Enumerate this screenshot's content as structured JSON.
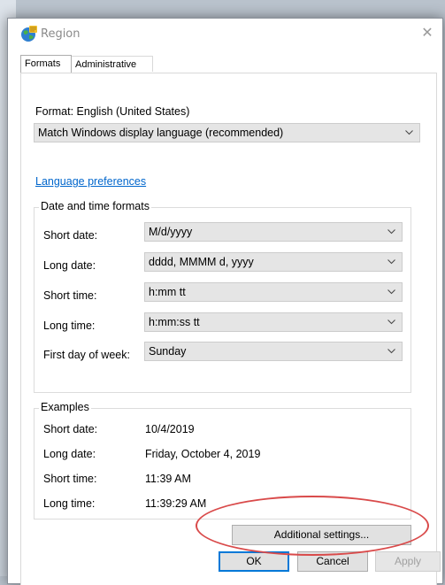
{
  "window": {
    "title": "Region",
    "close_glyph": "✕"
  },
  "tabs": [
    {
      "label": "Formats",
      "active": true
    },
    {
      "label": "Administrative",
      "active": false
    }
  ],
  "format": {
    "label": "Format: English (United States)",
    "value": "Match Windows display language (recommended)"
  },
  "links": {
    "language_preferences": "Language preferences"
  },
  "date_time_formats": {
    "title": "Date and time formats",
    "rows": [
      {
        "label": "Short date:",
        "value": "M/d/yyyy"
      },
      {
        "label": "Long date:",
        "value": "dddd, MMMM d, yyyy"
      },
      {
        "label": "Short time:",
        "value": "h:mm tt"
      },
      {
        "label": "Long time:",
        "value": "h:mm:ss tt"
      },
      {
        "label": "First day of week:",
        "value": "Sunday"
      }
    ]
  },
  "examples": {
    "title": "Examples",
    "rows": [
      {
        "label": "Short date:",
        "value": "10/4/2019"
      },
      {
        "label": "Long date:",
        "value": "Friday, October 4, 2019"
      },
      {
        "label": "Short time:",
        "value": "11:39 AM"
      },
      {
        "label": "Long time:",
        "value": "11:39:29 AM"
      }
    ]
  },
  "buttons": {
    "additional_settings": "Additional settings...",
    "ok": "OK",
    "cancel": "Cancel",
    "apply": "Apply"
  },
  "colors": {
    "link": "#0066cc",
    "highlight_ellipse": "#d94a4a",
    "combo_bg": "#e5e5e5"
  },
  "icons": {
    "title": "globe-icon",
    "dropdown": "chevron-down-icon",
    "close": "close-icon"
  }
}
